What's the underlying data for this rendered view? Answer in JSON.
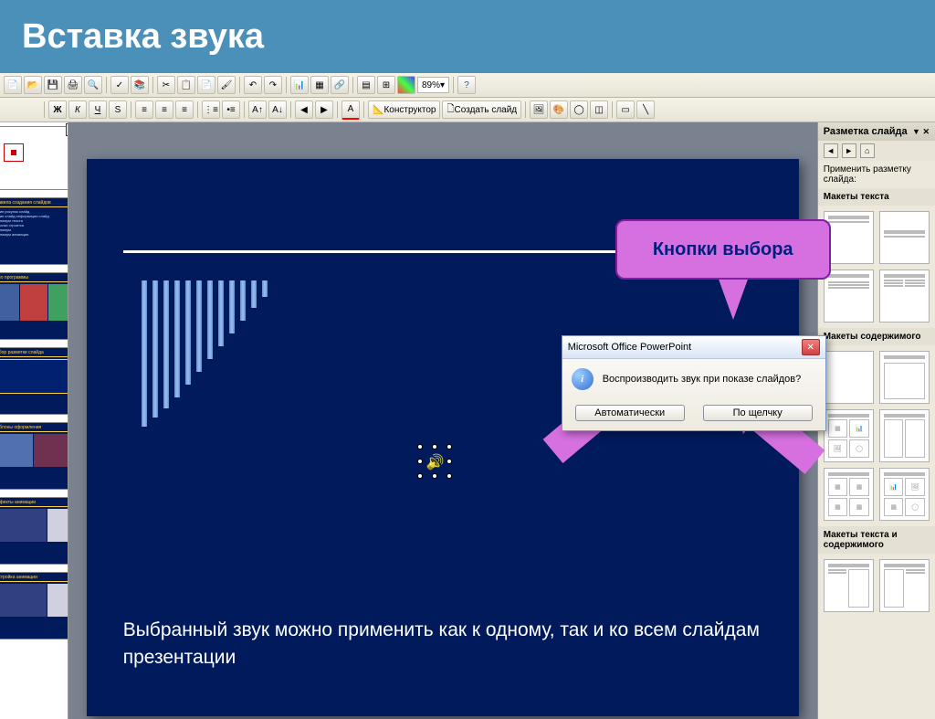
{
  "title": "Вставка звука",
  "toolbar": {
    "zoom": "89%",
    "constructor_label": "Конструктор",
    "new_slide_label": "Создать слайд"
  },
  "callout": {
    "label": "Кнопки выбора"
  },
  "dialog": {
    "title": "Microsoft Office PowerPoint",
    "message": "Воспроизводить звук при показе слайдов?",
    "btn_auto": "Автоматически",
    "btn_click": "По щелчку"
  },
  "slide": {
    "caption": "Выбранный звук можно применить как к одному, так и ко всем слайдам презентации"
  },
  "task_pane": {
    "title": "Разметка слайда",
    "apply": "Применить разметку слайда:",
    "section_text": "Макеты текста",
    "section_content": "Макеты содержимого",
    "section_text_content": "Макеты текста и содержимого"
  },
  "thumbs": {
    "close": "×"
  }
}
